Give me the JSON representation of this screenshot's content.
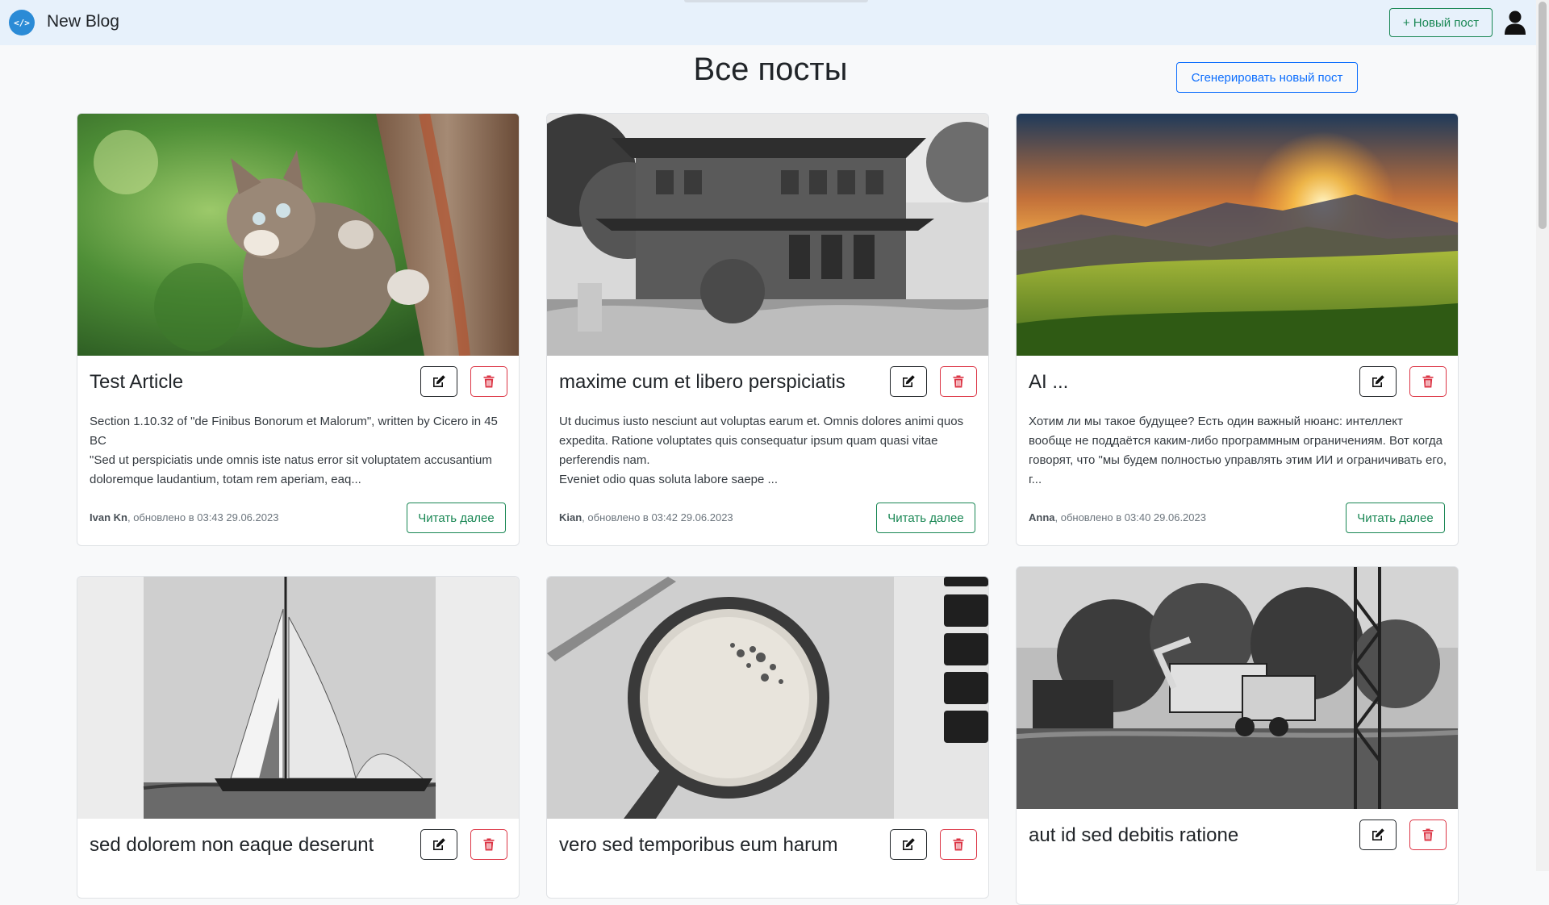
{
  "navbar": {
    "brand_logo": "</>",
    "brand_name": "New Blog",
    "new_post_label": "+ Новый пост",
    "user_icon": "user-icon"
  },
  "main": {
    "title": "Все посты",
    "generate_label": "Сгенерировать новый пост"
  },
  "posts": [
    {
      "title": "Test Article",
      "image": "kitten-climbing-tree",
      "excerpt": "Section 1.10.32 of \"de Finibus Bonorum et Malorum\", written by Cicero in 45 BC\n\"Sed ut perspiciatis unde omnis iste natus error sit voluptatem accusantium doloremque laudantium, totam rem aperiam, eaq...",
      "author": "Ivan Kn",
      "updated": ", обновлено в 03:43 29.06.2023",
      "read_more": "Читать далее"
    },
    {
      "title": "maxime cum et libero perspiciatis",
      "image": "brick-house-grayscale",
      "excerpt": "Ut ducimus iusto nesciunt aut voluptas earum et. Omnis dolores animi quos expedita. Ratione voluptates quis consequatur ipsum quam quasi vitae perferendis nam.\n Eveniet odio quas soluta labore saepe ...",
      "author": "Kian",
      "updated": ", обновлено в 03:42 29.06.2023",
      "read_more": "Читать далее"
    },
    {
      "title": "AI ...",
      "image": "sunset-mountains",
      "excerpt": "Хотим ли мы такое будущее? Есть один важный нюанс: интеллект вообще не поддаётся каким-либо программным ограничениям. Вот когда говорят, что \"мы будем полностью управлять этим ИИ и ограничивать его, г...",
      "author": "Anna",
      "updated": ", обновлено в 03:40 29.06.2023",
      "read_more": "Читать далее"
    },
    {
      "title": "sed dolorem non eaque deserunt",
      "image": "sailboat-grayscale"
    },
    {
      "title": "vero sed temporibus eum harum",
      "image": "coffee-cup-grayscale"
    },
    {
      "title": "aut id sed debitis ratione",
      "image": "excavator-grayscale"
    }
  ],
  "colors": {
    "navbar_bg": "#e7f1fb",
    "success": "#198754",
    "primary": "#0d6efd",
    "danger": "#dc3545"
  }
}
